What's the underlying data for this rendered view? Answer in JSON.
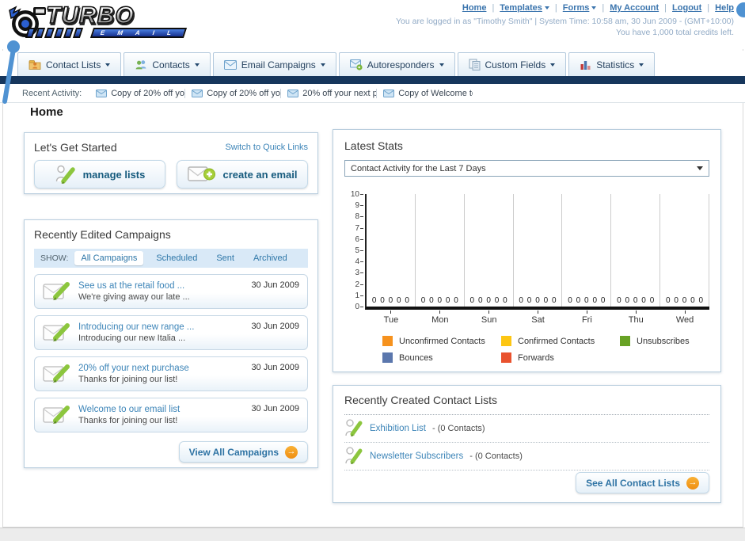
{
  "header": {
    "logo": {
      "title": "TURBO",
      "subtitle": "E M A I L"
    },
    "nav_links": [
      {
        "label": "Home"
      },
      {
        "label": "Templates",
        "dropdown": true
      },
      {
        "label": "Forms",
        "dropdown": true
      },
      {
        "label": "My Account"
      },
      {
        "label": "Logout"
      },
      {
        "label": "Help"
      }
    ],
    "login_info": "You are logged in as \"Timothy Smith\" | System Time: 10:58 am, 30 Jun 2009 - (GMT+10:00)",
    "credits_info": "You have 1,000 total credits left."
  },
  "nav_tabs": [
    {
      "label": "Contact Lists"
    },
    {
      "label": "Contacts"
    },
    {
      "label": "Email Campaigns"
    },
    {
      "label": "Autoresponders"
    },
    {
      "label": "Custom Fields"
    },
    {
      "label": "Statistics"
    }
  ],
  "recent_activity": {
    "label": "Recent Activity:",
    "items": [
      "Copy of 20% off yo",
      "Copy of 20% off yo",
      "20% off your next p",
      "Copy of Welcome to"
    ]
  },
  "page_title": "Home",
  "get_started": {
    "title": "Let's Get Started",
    "switch_link": "Switch to Quick Links",
    "buttons": [
      {
        "label": "manage lists"
      },
      {
        "label": "create an email"
      }
    ]
  },
  "campaigns": {
    "title": "Recently Edited Campaigns",
    "show_label": "SHOW:",
    "tabs": [
      {
        "label": "All Campaigns",
        "active": true
      },
      {
        "label": "Scheduled"
      },
      {
        "label": "Sent"
      },
      {
        "label": "Archived"
      }
    ],
    "items": [
      {
        "title": "See us at the retail food ...",
        "subtitle": "We're giving away our late ...",
        "date": "30 Jun 2009"
      },
      {
        "title": "Introducing our new range ...",
        "subtitle": "Introducing our new Italia ...",
        "date": "30 Jun 2009"
      },
      {
        "title": "20% off your next purchase",
        "subtitle": "Thanks for joining our list!",
        "date": "30 Jun 2009"
      },
      {
        "title": "Welcome to our email list",
        "subtitle": "Thanks for joining our list!",
        "date": "30 Jun 2009"
      }
    ],
    "view_all_label": "View All Campaigns"
  },
  "stats": {
    "title": "Latest Stats",
    "selected_option": "Contact Activity for the Last 7 Days"
  },
  "chart_data": {
    "type": "bar",
    "title": "Contact Activity for the Last 7 Days",
    "categories": [
      "Tue",
      "Mon",
      "Sun",
      "Sat",
      "Fri",
      "Thu",
      "Wed"
    ],
    "series": [
      {
        "name": "Unconfirmed Contacts",
        "color": "#f6921e",
        "values": [
          0,
          0,
          0,
          0,
          0,
          0,
          0
        ]
      },
      {
        "name": "Confirmed Contacts",
        "color": "#fdc613",
        "values": [
          0,
          0,
          0,
          0,
          0,
          0,
          0
        ]
      },
      {
        "name": "Unsubscribes",
        "color": "#68a225",
        "values": [
          0,
          0,
          0,
          0,
          0,
          0,
          0
        ]
      },
      {
        "name": "Bounces",
        "color": "#5b77ad",
        "values": [
          0,
          0,
          0,
          0,
          0,
          0,
          0
        ]
      },
      {
        "name": "Forwards",
        "color": "#e9522e",
        "values": [
          0,
          0,
          0,
          0,
          0,
          0,
          0
        ]
      }
    ],
    "xlabel": "",
    "ylabel": "",
    "ylim": [
      0,
      10
    ],
    "ytick_step": 1,
    "grid": "vertical",
    "legend_position": "bottom"
  },
  "contact_lists": {
    "title": "Recently Created Contact Lists",
    "items": [
      {
        "name": "Exhibition List",
        "count_text": "- (0 Contacts)"
      },
      {
        "name": "Newsletter Subscribers",
        "count_text": "- (0 Contacts)"
      }
    ],
    "see_all_label": "See All Contact Lists"
  }
}
